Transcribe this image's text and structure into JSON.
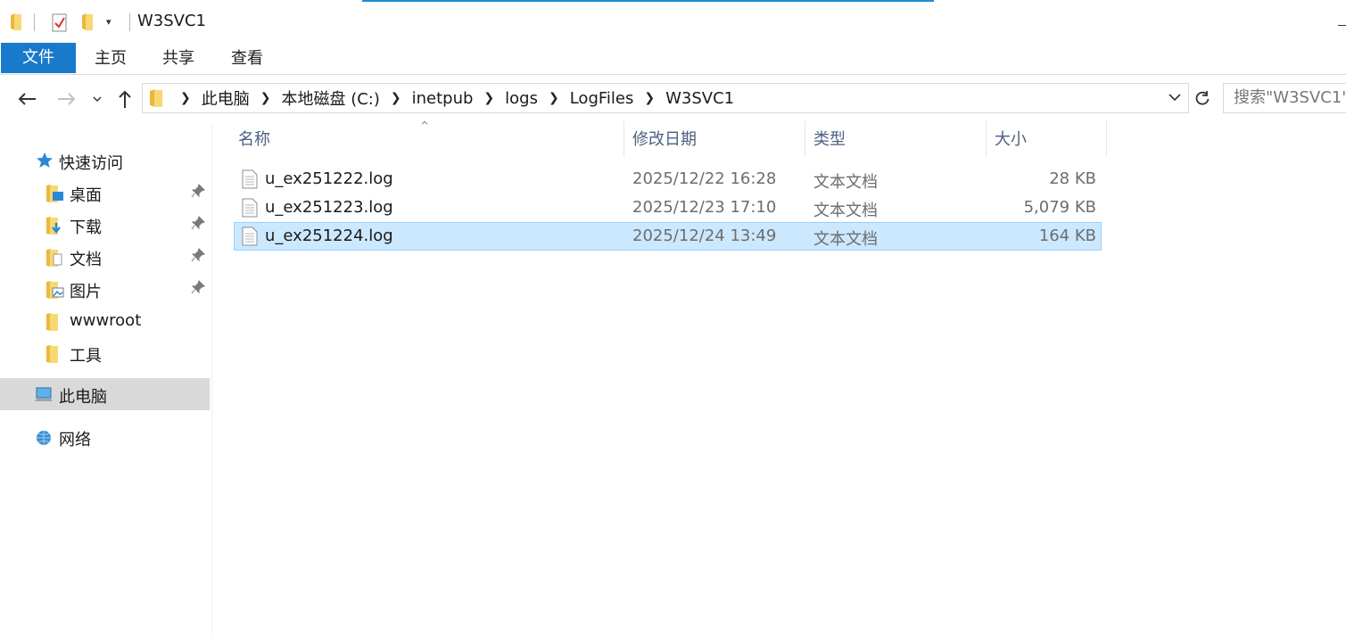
{
  "window": {
    "title": "W3SVC1"
  },
  "ribbon": {
    "tabs": [
      {
        "label": "文件",
        "active": true
      },
      {
        "label": "主页"
      },
      {
        "label": "共享"
      },
      {
        "label": "查看"
      }
    ]
  },
  "address": {
    "crumbs": [
      "此电脑",
      "本地磁盘 (C:)",
      "inetpub",
      "logs",
      "LogFiles",
      "W3SVC1"
    ],
    "search_placeholder": "搜索\"W3SVC1\""
  },
  "sidebar": {
    "quick_access": "快速访问",
    "items": [
      {
        "label": "桌面",
        "icon": "desktop-folder-icon",
        "pinned": true
      },
      {
        "label": "下载",
        "icon": "downloads-folder-icon",
        "pinned": true
      },
      {
        "label": "文档",
        "icon": "documents-folder-icon",
        "pinned": true
      },
      {
        "label": "图片",
        "icon": "pictures-folder-icon",
        "pinned": true
      },
      {
        "label": "wwwroot",
        "icon": "folder-icon",
        "pinned": false
      },
      {
        "label": "工具",
        "icon": "folder-icon",
        "pinned": false
      }
    ],
    "this_pc": "此电脑",
    "network": "网络"
  },
  "columns": {
    "name": "名称",
    "modified": "修改日期",
    "type": "类型",
    "size": "大小"
  },
  "files": [
    {
      "name": "u_ex251222.log",
      "modified": "2025/12/22 16:28",
      "type": "文本文档",
      "size": "28 KB",
      "selected": false
    },
    {
      "name": "u_ex251223.log",
      "modified": "2025/12/23 17:10",
      "type": "文本文档",
      "size": "5,079 KB",
      "selected": false
    },
    {
      "name": "u_ex251224.log",
      "modified": "2025/12/24 13:49",
      "type": "文本文档",
      "size": "164 KB",
      "selected": true
    }
  ],
  "colors": {
    "accent": "#1979ca",
    "selection": "#cce8ff",
    "folder": "#f8d775"
  }
}
